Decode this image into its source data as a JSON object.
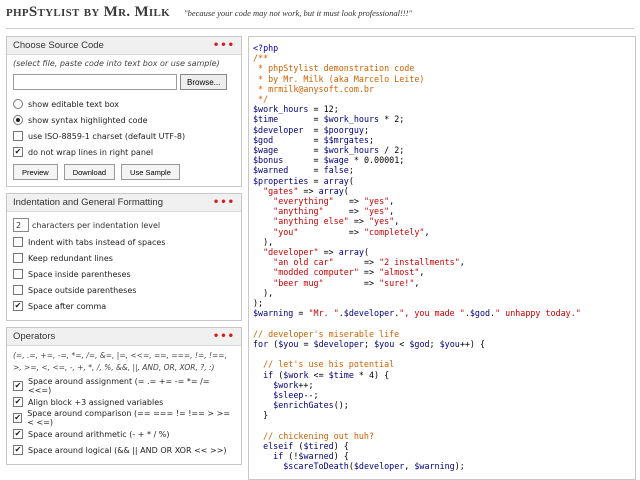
{
  "header": {
    "title": "phpStylist by Mr. Milk",
    "tagline": "\"because your code may not work, but it must look professional!!!\""
  },
  "source_panel": {
    "title": "Choose Source Code",
    "menu_dots": "•••",
    "hint": "(select file, paste code into text box or use sample)",
    "browse_label": "Browse...",
    "options": [
      {
        "label": "show editable text box",
        "type": "radio",
        "checked": false
      },
      {
        "label": "show syntax highlighted code",
        "type": "radio",
        "checked": true
      },
      {
        "label": "use ISO-8859-1 charset (default UTF-8)",
        "type": "checkbox",
        "checked": false
      },
      {
        "label": "do not wrap lines in right panel",
        "type": "checkbox",
        "checked": true
      }
    ],
    "buttons": [
      "Preview",
      "Download",
      "Use Sample"
    ]
  },
  "indent_panel": {
    "title": "Indentation and General Formatting",
    "menu_dots": "•••",
    "indent_value": "2",
    "indent_label": "characters per indentation level",
    "options": [
      {
        "label": "Indent with tabs instead of spaces",
        "checked": false
      },
      {
        "label": "Keep redundant lines",
        "checked": false
      },
      {
        "label": "Space inside parentheses",
        "checked": false
      },
      {
        "label": "Space outside parentheses",
        "checked": false
      },
      {
        "label": "Space after comma",
        "checked": true
      }
    ]
  },
  "operators_panel": {
    "title": "Operators",
    "menu_dots": "•••",
    "operators_text": "(=, .=, +=, -=, *=, /=, &=, |=, <<=, ==, ===, !=, !==, >, >=, <, <=, -, +, *, /, %, &&, ||, AND, OR, XOR, ?, :)",
    "options": [
      {
        "label": "Space around assignment (= .= += -= *= /= <<=)",
        "checked": true
      },
      {
        "label": "Align block +3 assigned variables",
        "checked": true
      },
      {
        "label": "Space around comparison (== === != !== > >= < <=)",
        "checked": true
      },
      {
        "label": "Space around arithmetic (- + * / %)",
        "checked": true
      },
      {
        "label": "Space around logical (&& || AND OR XOR << >>)",
        "checked": true
      }
    ]
  },
  "code_lines": [
    [
      [
        "c-tag",
        "<?php"
      ]
    ],
    [
      [
        "c-cm",
        "/**"
      ]
    ],
    [
      [
        "c-cm",
        " * phpStylist demonstration code"
      ]
    ],
    [
      [
        "c-cm",
        " * by Mr. Milk (aka Marcelo Leite)"
      ]
    ],
    [
      [
        "c-cm",
        " * mrmilk@anysoft.com.br"
      ]
    ],
    [
      [
        "c-cm",
        " */"
      ]
    ],
    [
      [
        "c-var",
        "$work_hours"
      ],
      [
        "c-op",
        " = "
      ],
      [
        "c-op",
        "12;"
      ]
    ],
    [
      [
        "c-var",
        "$time"
      ],
      [
        "c-op",
        "       = "
      ],
      [
        "c-var",
        "$work_hours"
      ],
      [
        "c-op",
        " * 2;"
      ]
    ],
    [
      [
        "c-var",
        "$developer"
      ],
      [
        "c-op",
        "  = "
      ],
      [
        "c-var",
        "$poorguy"
      ],
      [
        "c-op",
        ";"
      ]
    ],
    [
      [
        "c-var",
        "$god"
      ],
      [
        "c-op",
        "        = "
      ],
      [
        "c-var",
        "$$mrgates"
      ],
      [
        "c-op",
        ";"
      ]
    ],
    [
      [
        "c-var",
        "$wage"
      ],
      [
        "c-op",
        "       = "
      ],
      [
        "c-var",
        "$work_hours"
      ],
      [
        "c-op",
        " / 2;"
      ]
    ],
    [
      [
        "c-var",
        "$bonus"
      ],
      [
        "c-op",
        "      = "
      ],
      [
        "c-var",
        "$wage"
      ],
      [
        "c-op",
        " * 0.00001;"
      ]
    ],
    [
      [
        "c-var",
        "$warned"
      ],
      [
        "c-op",
        "     = "
      ],
      [
        "c-kw",
        "false"
      ],
      [
        "c-op",
        ";"
      ]
    ],
    [
      [
        "c-var",
        "$properties"
      ],
      [
        "c-op",
        " = "
      ],
      [
        "c-kw",
        "array"
      ],
      [
        "c-op",
        "("
      ]
    ],
    [
      [
        "c-op",
        "  "
      ],
      [
        "c-str",
        "\"gates\""
      ],
      [
        "c-op",
        " => "
      ],
      [
        "c-kw",
        "array"
      ],
      [
        "c-op",
        "("
      ]
    ],
    [
      [
        "c-op",
        "    "
      ],
      [
        "c-str",
        "\"everything\""
      ],
      [
        "c-op",
        "   => "
      ],
      [
        "c-str",
        "\"yes\""
      ],
      [
        "c-op",
        ","
      ]
    ],
    [
      [
        "c-op",
        "    "
      ],
      [
        "c-str",
        "\"anything\""
      ],
      [
        "c-op",
        "     => "
      ],
      [
        "c-str",
        "\"yes\""
      ],
      [
        "c-op",
        ","
      ]
    ],
    [
      [
        "c-op",
        "    "
      ],
      [
        "c-str",
        "\"anything else\""
      ],
      [
        "c-op",
        " => "
      ],
      [
        "c-str",
        "\"yes\""
      ],
      [
        "c-op",
        ","
      ]
    ],
    [
      [
        "c-op",
        "    "
      ],
      [
        "c-str",
        "\"you\""
      ],
      [
        "c-op",
        "          => "
      ],
      [
        "c-str",
        "\"completely\""
      ],
      [
        "c-op",
        ","
      ]
    ],
    [
      [
        "c-op",
        "  ),"
      ]
    ],
    [
      [
        "c-op",
        "  "
      ],
      [
        "c-str",
        "\"developer\""
      ],
      [
        "c-op",
        " => "
      ],
      [
        "c-kw",
        "array"
      ],
      [
        "c-op",
        "("
      ]
    ],
    [
      [
        "c-op",
        "    "
      ],
      [
        "c-str",
        "\"an old car\""
      ],
      [
        "c-op",
        "      => "
      ],
      [
        "c-str",
        "\"2 installments\""
      ],
      [
        "c-op",
        ","
      ]
    ],
    [
      [
        "c-op",
        "    "
      ],
      [
        "c-str",
        "\"modded computer\""
      ],
      [
        "c-op",
        " => "
      ],
      [
        "c-str",
        "\"almost\""
      ],
      [
        "c-op",
        ","
      ]
    ],
    [
      [
        "c-op",
        "    "
      ],
      [
        "c-str",
        "\"beer mug\""
      ],
      [
        "c-op",
        "        => "
      ],
      [
        "c-str",
        "\"sure!\""
      ],
      [
        "c-op",
        ","
      ]
    ],
    [
      [
        "c-op",
        "  ),"
      ]
    ],
    [
      [
        "c-op",
        ");"
      ]
    ],
    [
      [
        "c-var",
        "$warning"
      ],
      [
        "c-op",
        " = "
      ],
      [
        "c-str",
        "\"Mr. \""
      ],
      [
        "c-op",
        "."
      ],
      [
        "c-var",
        "$developer"
      ],
      [
        "c-op",
        "."
      ],
      [
        "c-str",
        "\", you made \""
      ],
      [
        "c-op",
        "."
      ],
      [
        "c-var",
        "$god"
      ],
      [
        "c-op",
        "."
      ],
      [
        "c-str",
        "\" unhappy today.\""
      ]
    ],
    [
      [
        "c-op",
        ""
      ]
    ],
    [
      [
        "c-cm",
        "// developer's miserable life"
      ]
    ],
    [
      [
        "c-kw",
        "for"
      ],
      [
        "c-op",
        " ("
      ],
      [
        "c-var",
        "$you"
      ],
      [
        "c-op",
        " = "
      ],
      [
        "c-var",
        "$developer"
      ],
      [
        "c-op",
        "; "
      ],
      [
        "c-var",
        "$you"
      ],
      [
        "c-op",
        " < "
      ],
      [
        "c-var",
        "$god"
      ],
      [
        "c-op",
        "; "
      ],
      [
        "c-var",
        "$you"
      ],
      [
        "c-op",
        "++) {"
      ]
    ],
    [
      [
        "c-op",
        ""
      ]
    ],
    [
      [
        "c-op",
        "  "
      ],
      [
        "c-cm",
        "// let's use his potential"
      ]
    ],
    [
      [
        "c-op",
        "  "
      ],
      [
        "c-kw",
        "if"
      ],
      [
        "c-op",
        " ("
      ],
      [
        "c-var",
        "$work"
      ],
      [
        "c-op",
        " <= "
      ],
      [
        "c-var",
        "$time"
      ],
      [
        "c-op",
        " * 4) {"
      ]
    ],
    [
      [
        "c-op",
        "    "
      ],
      [
        "c-var",
        "$work"
      ],
      [
        "c-op",
        "++;"
      ]
    ],
    [
      [
        "c-op",
        "    "
      ],
      [
        "c-var",
        "$sleep"
      ],
      [
        "c-op",
        "--;"
      ]
    ],
    [
      [
        "c-op",
        "    "
      ],
      [
        "c-var",
        "$enrichGates"
      ],
      [
        "c-op",
        "();"
      ]
    ],
    [
      [
        "c-op",
        "  }"
      ]
    ],
    [
      [
        "c-op",
        ""
      ]
    ],
    [
      [
        "c-op",
        "  "
      ],
      [
        "c-cm",
        "// chickening out huh?"
      ]
    ],
    [
      [
        "c-op",
        "  "
      ],
      [
        "c-kw",
        "elseif"
      ],
      [
        "c-op",
        " ("
      ],
      [
        "c-var",
        "$tired"
      ],
      [
        "c-op",
        ") {"
      ]
    ],
    [
      [
        "c-op",
        "    "
      ],
      [
        "c-kw",
        "if"
      ],
      [
        "c-op",
        " (!"
      ],
      [
        "c-var",
        "$warned"
      ],
      [
        "c-op",
        ") {"
      ]
    ],
    [
      [
        "c-op",
        "      "
      ],
      [
        "c-var",
        "$scareToDeath"
      ],
      [
        "c-op",
        "("
      ],
      [
        "c-var",
        "$developer"
      ],
      [
        "c-op",
        ", "
      ],
      [
        "c-var",
        "$warning"
      ],
      [
        "c-op",
        ");"
      ]
    ]
  ]
}
